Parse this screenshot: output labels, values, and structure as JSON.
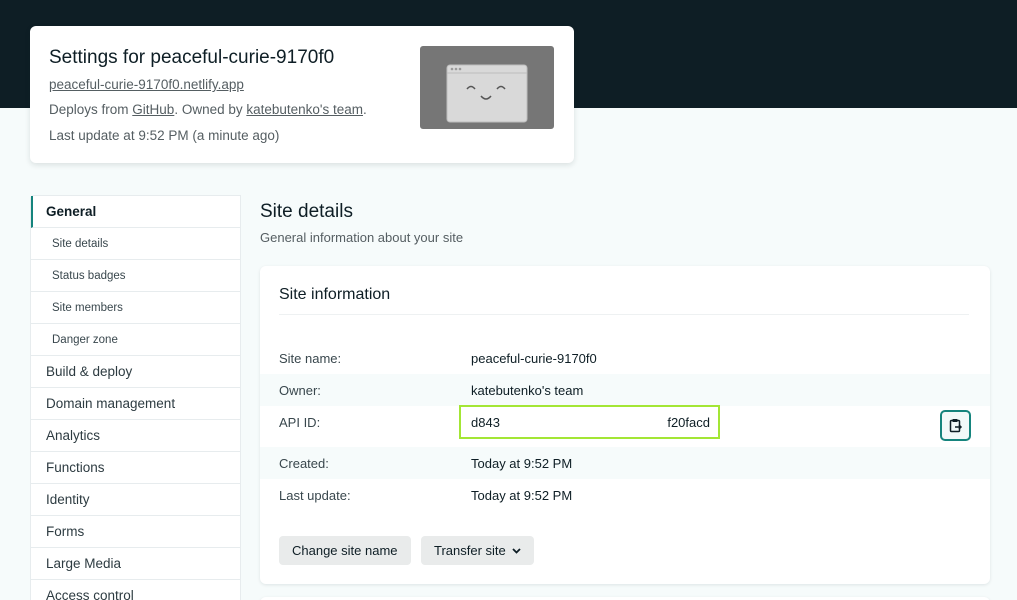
{
  "header": {
    "title": "Settings for peaceful-curie-9170f0",
    "url": "peaceful-curie-9170f0.netlify.app",
    "deploys_prefix": "Deploys from ",
    "deploys_source": "GitHub",
    "owned_prefix": ". Owned by ",
    "owner_link": "katebutenko's team",
    "owned_suffix": ".",
    "last_update": "Last update at 9:52 PM (a minute ago)"
  },
  "sidebar": {
    "items": [
      {
        "label": "General"
      },
      {
        "label": "Site details"
      },
      {
        "label": "Status badges"
      },
      {
        "label": "Site members"
      },
      {
        "label": "Danger zone"
      },
      {
        "label": "Build & deploy"
      },
      {
        "label": "Domain management"
      },
      {
        "label": "Analytics"
      },
      {
        "label": "Functions"
      },
      {
        "label": "Identity"
      },
      {
        "label": "Forms"
      },
      {
        "label": "Large Media"
      },
      {
        "label": "Access control"
      }
    ]
  },
  "main": {
    "section_title": "Site details",
    "section_subtitle": "General information about your site",
    "card_title": "Site information",
    "rows": {
      "site_name": {
        "label": "Site name:",
        "value": "peaceful-curie-9170f0"
      },
      "owner": {
        "label": "Owner:",
        "value": "katebutenko's team"
      },
      "api_id": {
        "label": "API ID:",
        "value_start": "d843",
        "value_end": "f20facd"
      },
      "created": {
        "label": "Created:",
        "value": "Today at 9:52 PM"
      },
      "last_update": {
        "label": "Last update:",
        "value": "Today at 9:52 PM"
      }
    },
    "buttons": {
      "change_name": "Change site name",
      "transfer": "Transfer site"
    }
  },
  "colors": {
    "header_bg": "#0e1e25",
    "accent_teal": "#15847d",
    "highlight_green": "#a3e635"
  }
}
